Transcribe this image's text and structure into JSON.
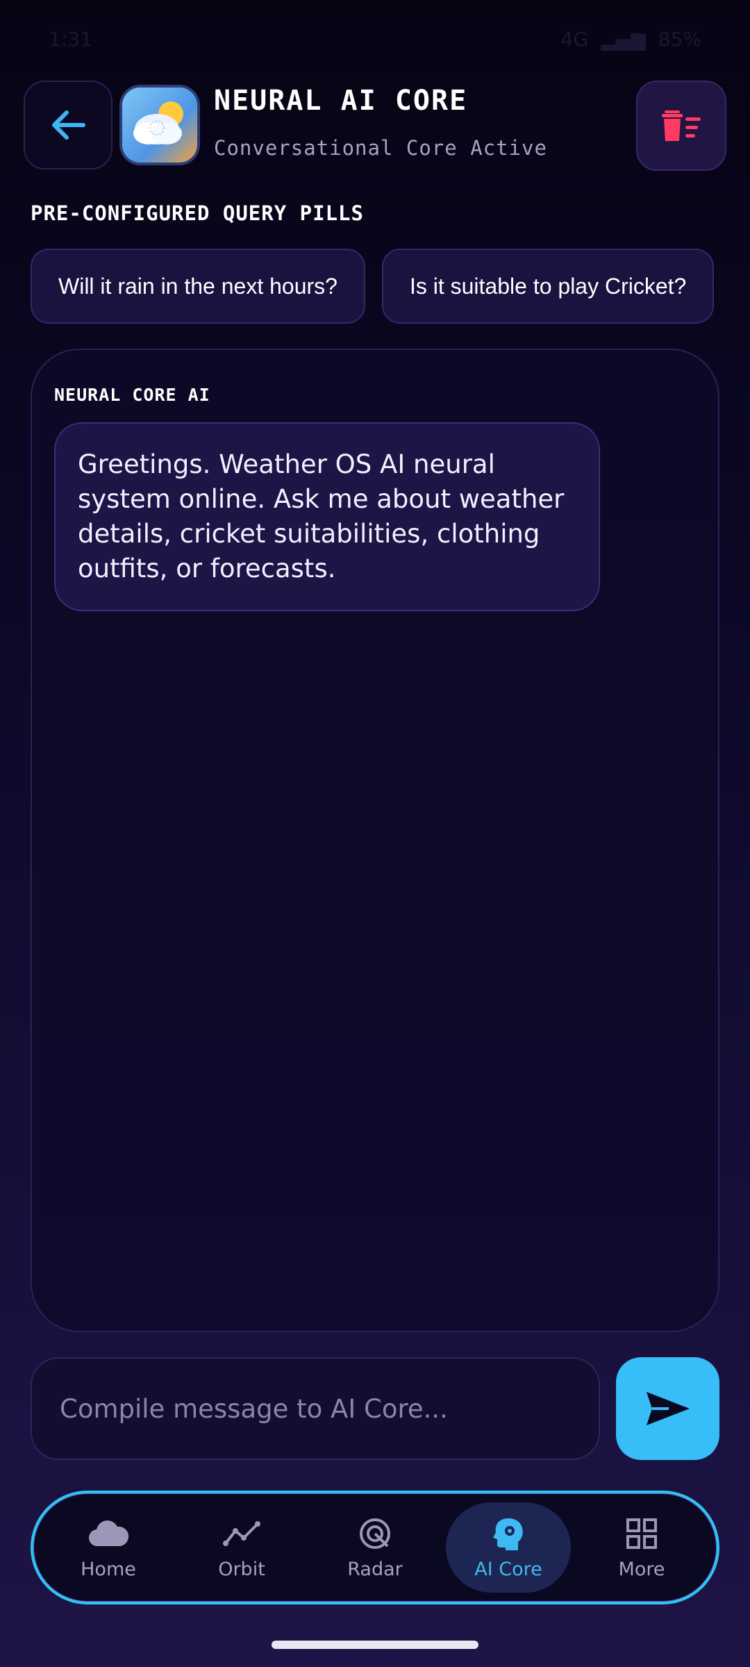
{
  "status_bar": {
    "time": "1:31",
    "network": "4G",
    "battery": "85%"
  },
  "header": {
    "title": "NEURAL AI CORE",
    "subtitle": "Conversational Core Active"
  },
  "pills": {
    "label": "PRE-CONFIGURED QUERY PILLS",
    "items": [
      {
        "label": "Will it rain in the next hours?"
      },
      {
        "label": "Is it suitable to play Cricket?"
      }
    ]
  },
  "chat": {
    "messages": [
      {
        "sender": "NEURAL CORE AI",
        "text": "Greetings. Weather OS AI neural system online. Ask me about weather details, cricket suitabilities, clothing outfits, or forecasts."
      }
    ]
  },
  "composer": {
    "placeholder": "Compile message to AI Core..."
  },
  "nav": {
    "items": [
      {
        "label": "Home",
        "icon": "cloud-icon"
      },
      {
        "label": "Orbit",
        "icon": "line-chart-icon"
      },
      {
        "label": "Radar",
        "icon": "radar-icon"
      },
      {
        "label": "AI Core",
        "icon": "brain-icon",
        "active": true
      },
      {
        "label": "More",
        "icon": "grid-icon"
      }
    ]
  },
  "colors": {
    "accent": "#37bdf7",
    "danger": "#ff3b63",
    "background": "#0c0826"
  }
}
